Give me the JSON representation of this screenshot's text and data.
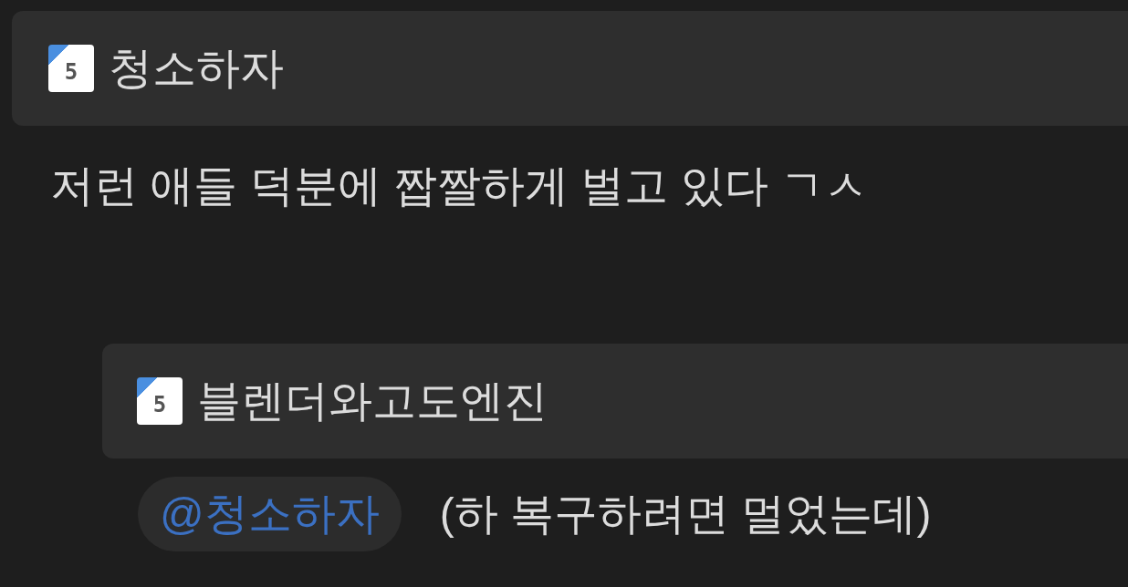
{
  "comments": [
    {
      "author": {
        "name": "청소하자",
        "badge": "5"
      },
      "text": "저런 애들 덕분에 짭짤하게 벌고 있다 ㄱㅅ",
      "replies": [
        {
          "author": {
            "name": "블렌더와고도엔진",
            "badge": "5"
          },
          "mention": "@청소하자",
          "text": "(하 복구하려면 멀었는데)"
        }
      ]
    }
  ]
}
